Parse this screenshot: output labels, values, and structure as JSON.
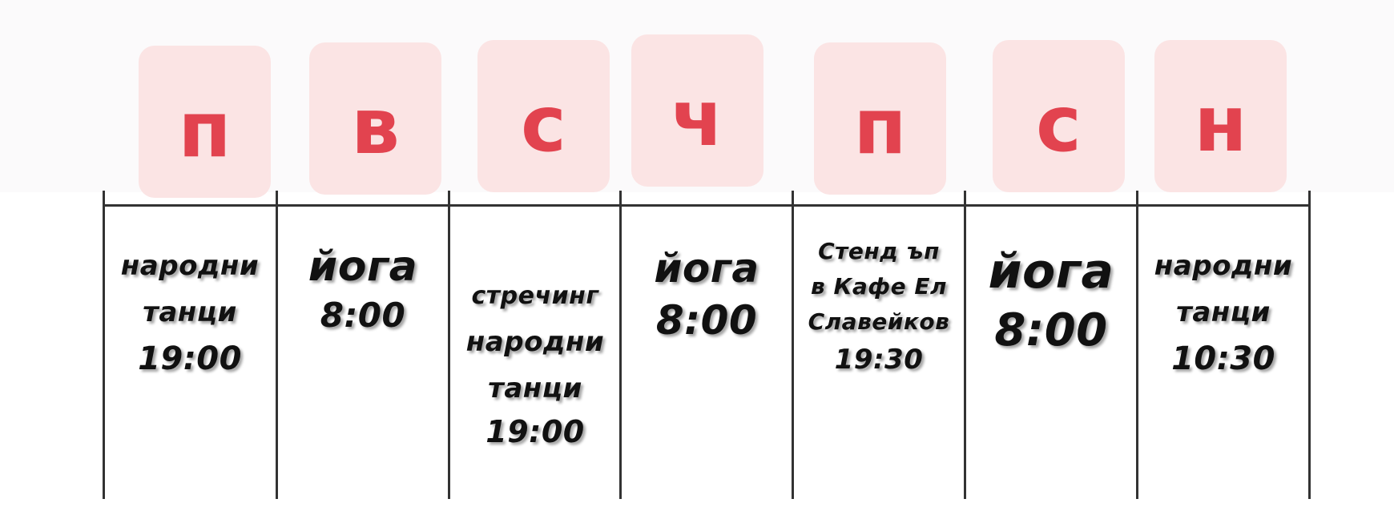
{
  "colors": {
    "accent": "#e2434f",
    "day_box_bg": "#fbe4e4",
    "grid_line": "#333333"
  },
  "days": [
    {
      "letter": "п",
      "lines": [
        "народни",
        "танци",
        "19:00"
      ]
    },
    {
      "letter": "в",
      "lines": [
        "йога",
        "8:00"
      ]
    },
    {
      "letter": "с",
      "lines": [
        "стречинг",
        "народни",
        "танци",
        "19:00"
      ]
    },
    {
      "letter": "ч",
      "lines": [
        "йога",
        "8:00"
      ]
    },
    {
      "letter": "п",
      "lines": [
        "Стенд ъп",
        "в Кафе Ел",
        "Славейков",
        "19:30"
      ]
    },
    {
      "letter": "с",
      "lines": [
        "йога",
        "8:00"
      ]
    },
    {
      "letter": "н",
      "lines": [
        "народни",
        "танци",
        "10:30"
      ]
    }
  ]
}
